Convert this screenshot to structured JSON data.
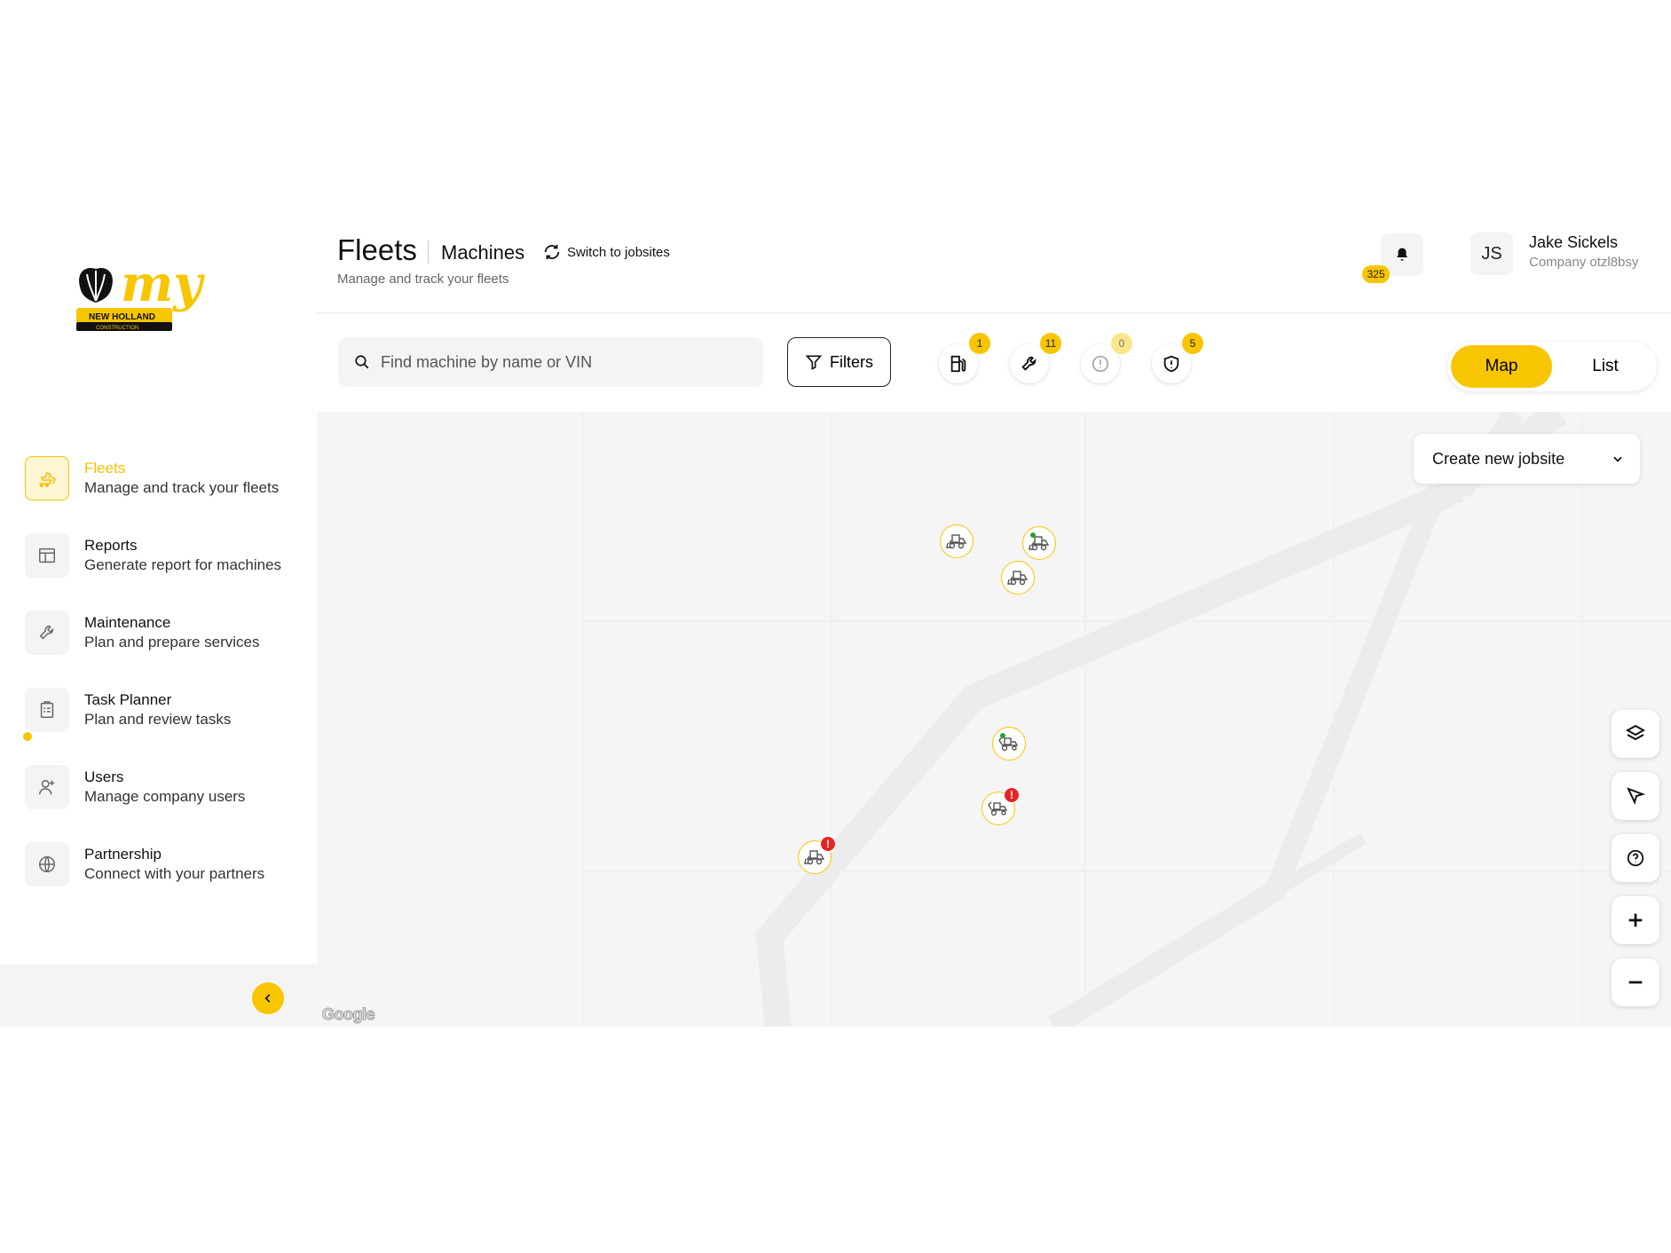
{
  "brand": {
    "logo_word": "my",
    "logo_caption": "NEW HOLLAND",
    "logo_subcaption": "CONSTRUCTION",
    "accent": "#f7c600"
  },
  "sidebar": {
    "items": [
      {
        "title": "Fleets",
        "subtitle": "Manage and track your fleets",
        "icon": "excavator-icon",
        "active": true
      },
      {
        "title": "Reports",
        "subtitle": "Generate report for machines",
        "icon": "report-layout-icon"
      },
      {
        "title": "Maintenance",
        "subtitle": "Plan and prepare services",
        "icon": "wrench-icon"
      },
      {
        "title": "Task Planner",
        "subtitle": "Plan and review tasks",
        "icon": "clipboard-icon"
      },
      {
        "title": "Users",
        "subtitle": "Manage company users",
        "icon": "add-user-icon"
      },
      {
        "title": "Partnership",
        "subtitle": "Connect with your partners",
        "icon": "globe-icon"
      }
    ]
  },
  "header": {
    "title": "Fleets",
    "tab": "Machines",
    "switch_label": "Switch to jobsites",
    "description": "Manage and track your fleets",
    "notifications_count": "325",
    "user": {
      "initials": "JS",
      "name": "Jake Sickels",
      "company": "Company otzl8bsy"
    }
  },
  "toolbar": {
    "search_placeholder": "Find machine by name or VIN",
    "filters_label": "Filters",
    "status": [
      {
        "icon": "fuel-icon",
        "count": "1"
      },
      {
        "icon": "wrench-icon",
        "count": "11"
      },
      {
        "icon": "alert-circle-icon",
        "count": "0"
      },
      {
        "icon": "shield-alert-icon",
        "count": "5"
      }
    ],
    "view_map": "Map",
    "view_list": "List"
  },
  "map": {
    "jobsite_dropdown": "Create new jobsite",
    "google_label": "Google",
    "markers": [
      {
        "type": "loader",
        "alert": false,
        "online": false
      },
      {
        "type": "loader",
        "alert": false,
        "online": true
      },
      {
        "type": "loader",
        "alert": false,
        "online": false
      },
      {
        "type": "backhoe",
        "alert": false,
        "online": true
      },
      {
        "type": "backhoe",
        "alert": true,
        "online": false
      },
      {
        "type": "loader",
        "alert": true,
        "online": false
      }
    ],
    "controls": [
      "layers-icon",
      "locate-arrow-icon",
      "help-icon",
      "zoom-in-icon",
      "zoom-out-icon"
    ]
  }
}
